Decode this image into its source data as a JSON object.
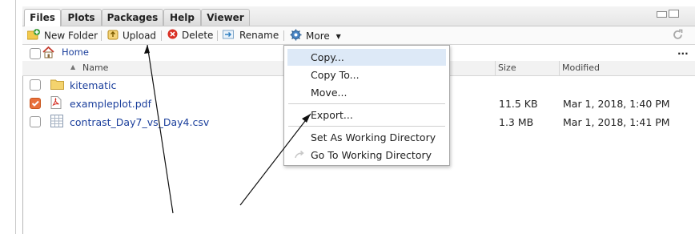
{
  "tabs": [
    {
      "label": "Files",
      "active": true
    },
    {
      "label": "Plots",
      "active": false
    },
    {
      "label": "Packages",
      "active": false
    },
    {
      "label": "Help",
      "active": false
    },
    {
      "label": "Viewer",
      "active": false
    }
  ],
  "toolbar": {
    "new_folder": "New Folder",
    "upload": "Upload",
    "delete": "Delete",
    "rename": "Rename",
    "more": "More"
  },
  "path": {
    "home": "Home",
    "overflow": "..."
  },
  "columns": {
    "name": "Name",
    "size": "Size",
    "modified": "Modified"
  },
  "files": [
    {
      "name": "kitematic",
      "type": "folder",
      "checked": false,
      "size": "",
      "modified": ""
    },
    {
      "name": "exampleplot.pdf",
      "type": "pdf",
      "checked": true,
      "size": "11.5 KB",
      "modified": "Mar 1, 2018, 1:40 PM"
    },
    {
      "name": "contrast_Day7_vs_Day4.csv",
      "type": "csv",
      "checked": false,
      "size": "1.3 MB",
      "modified": "Mar 1, 2018, 1:41 PM"
    }
  ],
  "more_menu": [
    {
      "label": "Copy...",
      "highlighted": true
    },
    {
      "label": "Copy To...",
      "highlighted": false
    },
    {
      "label": "Move...",
      "highlighted": false
    },
    {
      "label": "Export...",
      "highlighted": false
    },
    {
      "label": "Set As Working Directory",
      "highlighted": false
    },
    {
      "label": "Go To Working Directory",
      "highlighted": false
    }
  ],
  "colors": {
    "accent": "#1b3f9c",
    "checked": "#e8703c",
    "menu_highlight": "#dde9f7"
  }
}
